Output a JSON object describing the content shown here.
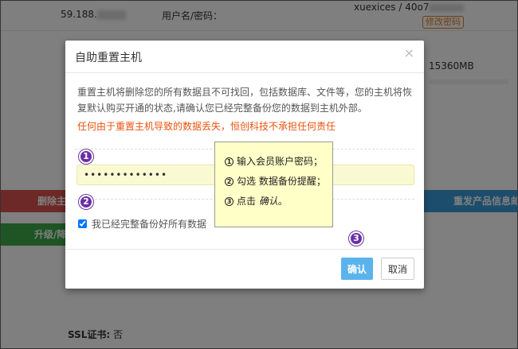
{
  "background": {
    "ip_prefix": "59.188.",
    "cred_label": "用户名/密码：",
    "username": "xuexices / 40o7",
    "change_password": "修改密码",
    "disk_size": "15360MB",
    "red_button": "删除主",
    "green_button": "升级/降",
    "blue_button": "重发产品信息邮",
    "ssl_label": "SSL证书:",
    "ssl_value": "否"
  },
  "modal": {
    "title": "自助重置主机",
    "close_glyph": "×",
    "description": "重置主机将删除您的所有数据且不可找回，包括数据库、文件等，您的主机将恢复默认购买开通的状态,请确认您已经完整备份您的数据到主机外部。",
    "warning": "任何由于重置主机导致的数据丢失，恒创科技不承担任何责任",
    "password_value": "•••••••••••••",
    "checkbox_label": "我已经完整备份好所有数据",
    "checkbox_checked": true,
    "ok_label": "确认",
    "cancel_label": "取消"
  },
  "badges": [
    "1",
    "2",
    "3"
  ],
  "note": {
    "step1_num": "1",
    "step1": "输入会员账户密码；",
    "step2_num": "2",
    "step2": "勾选 数据备份提醒；",
    "step3_num": "3",
    "step3_prefix": "点击 ",
    "step3_em": "确认",
    "step3_suffix": "。"
  },
  "colors": {
    "warning": "#e8540e",
    "badge": "#6a2fa5",
    "ok_button": "#5bb3ec",
    "note_bg": "#ffffc8",
    "input_bg": "#fafad2"
  }
}
